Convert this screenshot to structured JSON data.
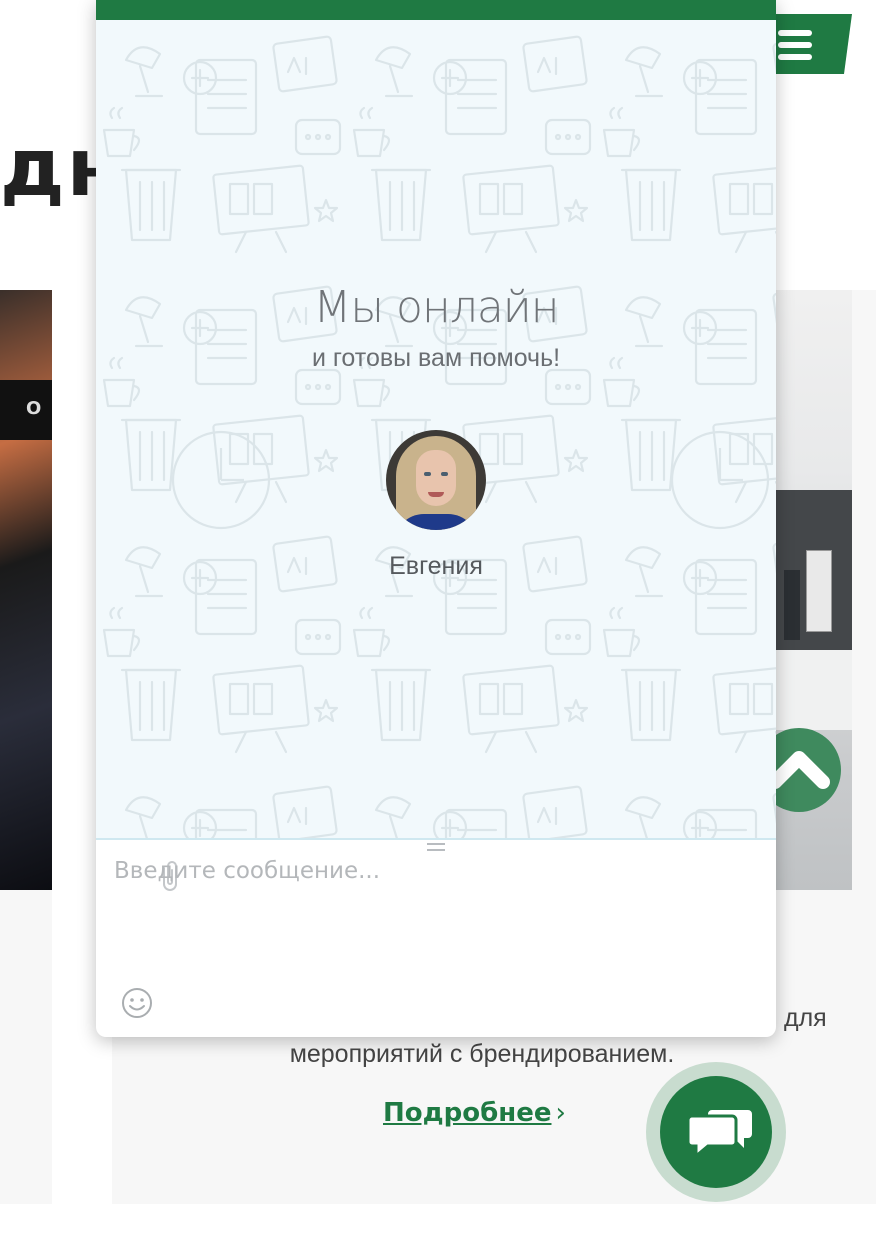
{
  "page": {
    "heading_fragment": "дн",
    "card": {
      "description_line1_end": "для",
      "description_line2": "мероприятий с брендированием.",
      "more_link": "Подробнее",
      "more_chevron": "›"
    },
    "colors": {
      "brand_green": "#1f7a43",
      "scroll_green": "#3f8a5e"
    }
  },
  "chat": {
    "title": "Мы онлайн",
    "subtitle": "и готовы вам помочь!",
    "agent_name": "Евгения",
    "input_placeholder": "Введите сообщение...",
    "icons": [
      "paperclip-icon",
      "emoji-icon",
      "chat-bubbles-icon",
      "hamburger-menu-icon",
      "chevron-up-icon"
    ]
  }
}
